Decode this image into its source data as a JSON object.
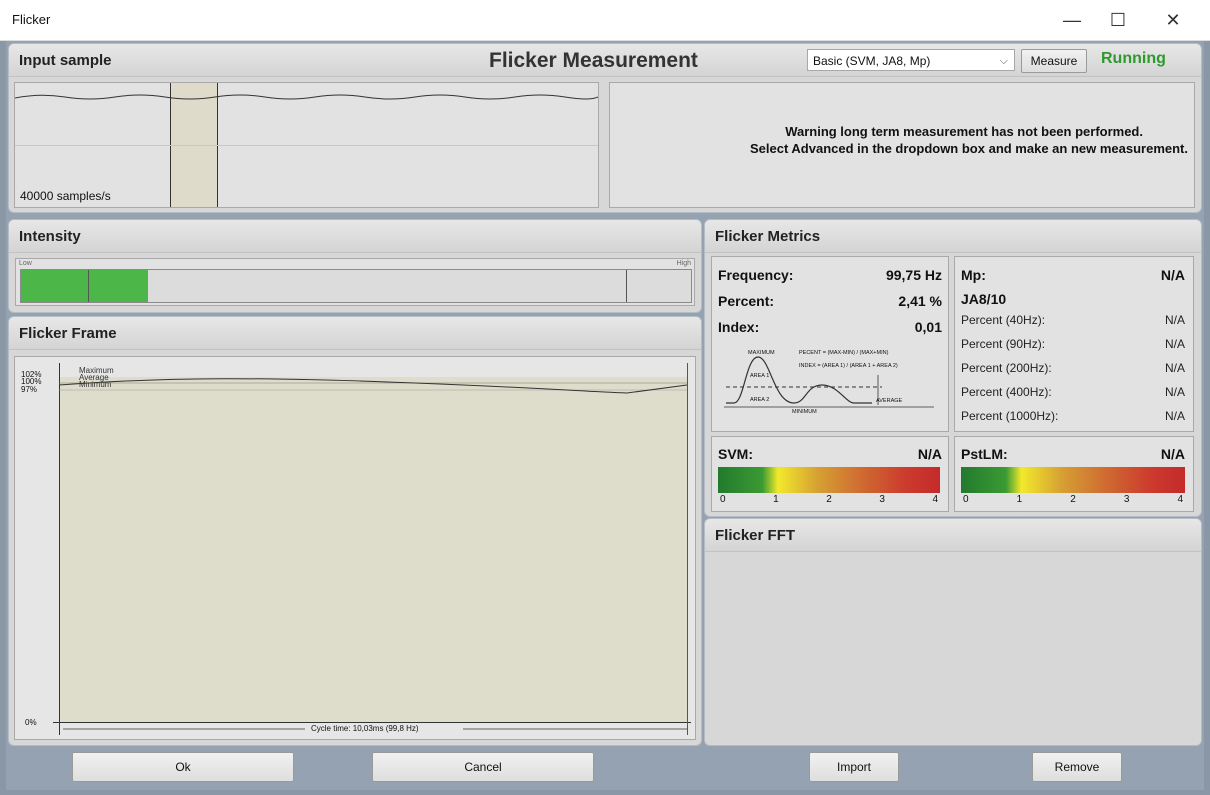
{
  "window": {
    "title": "Flicker",
    "minimize": "—",
    "maximize": "☐",
    "close": "✕"
  },
  "header": {
    "title": "Flicker Measurement",
    "mode_select": "Basic (SVM, JA8, Mp)",
    "measure_button": "Measure",
    "status": "Running",
    "status_color": "#2e9a2e"
  },
  "input_sample": {
    "title": "Input sample",
    "rate_label": "40000 samples/s",
    "warning_line1": "Warning long term measurement has not been performed.",
    "warning_line2": "Select Advanced in the dropdown box and make an new measurement."
  },
  "intensity": {
    "title": "Intensity",
    "low_label": "Low",
    "high_label": "High",
    "level_fraction": 0.19,
    "bar_color": "#4cb748"
  },
  "flicker_frame": {
    "title": "Flicker Frame",
    "y_labels": [
      "102%",
      "100%",
      "97%",
      "0%"
    ],
    "legend": [
      "Maximum",
      "Average",
      "Minimum"
    ],
    "cycle_label": "Cycle time: 10,03ms (99,8 Hz)"
  },
  "metrics": {
    "title": "Flicker Metrics",
    "frequency_label": "Frequency:",
    "frequency_value": "99,75 Hz",
    "percent_label": "Percent:",
    "percent_value": "2,41 %",
    "index_label": "Index:",
    "index_value": "0,01",
    "diagram": {
      "maximum": "MAXIMUM",
      "minimum": "MINIMUM",
      "average": "AVERAGE",
      "area1": "AREA 1",
      "area2": "AREA 2",
      "percent_formula": "PECENT = (MAX-MIN) / (MAX+MIN)",
      "index_formula": "INDEX = (AREA 1) / (AREA 1 + AREA 2)"
    },
    "mp_label": "Mp:",
    "mp_value": "N/A",
    "ja8_label": "JA8/10",
    "ja8_rows": [
      {
        "label": "Percent (40Hz):",
        "value": "N/A"
      },
      {
        "label": "Percent (90Hz):",
        "value": "N/A"
      },
      {
        "label": "Percent (200Hz):",
        "value": "N/A"
      },
      {
        "label": "Percent (400Hz):",
        "value": "N/A"
      },
      {
        "label": "Percent (1000Hz):",
        "value": "N/A"
      }
    ],
    "svm_label": "SVM:",
    "svm_value": "N/A",
    "pstlm_label": "PstLM:",
    "pstlm_value": "N/A",
    "scale_ticks": [
      "0",
      "1",
      "2",
      "3",
      "4"
    ]
  },
  "fft": {
    "title": "Flicker FFT"
  },
  "buttons": {
    "ok": "Ok",
    "cancel": "Cancel",
    "import": "Import",
    "remove": "Remove"
  }
}
